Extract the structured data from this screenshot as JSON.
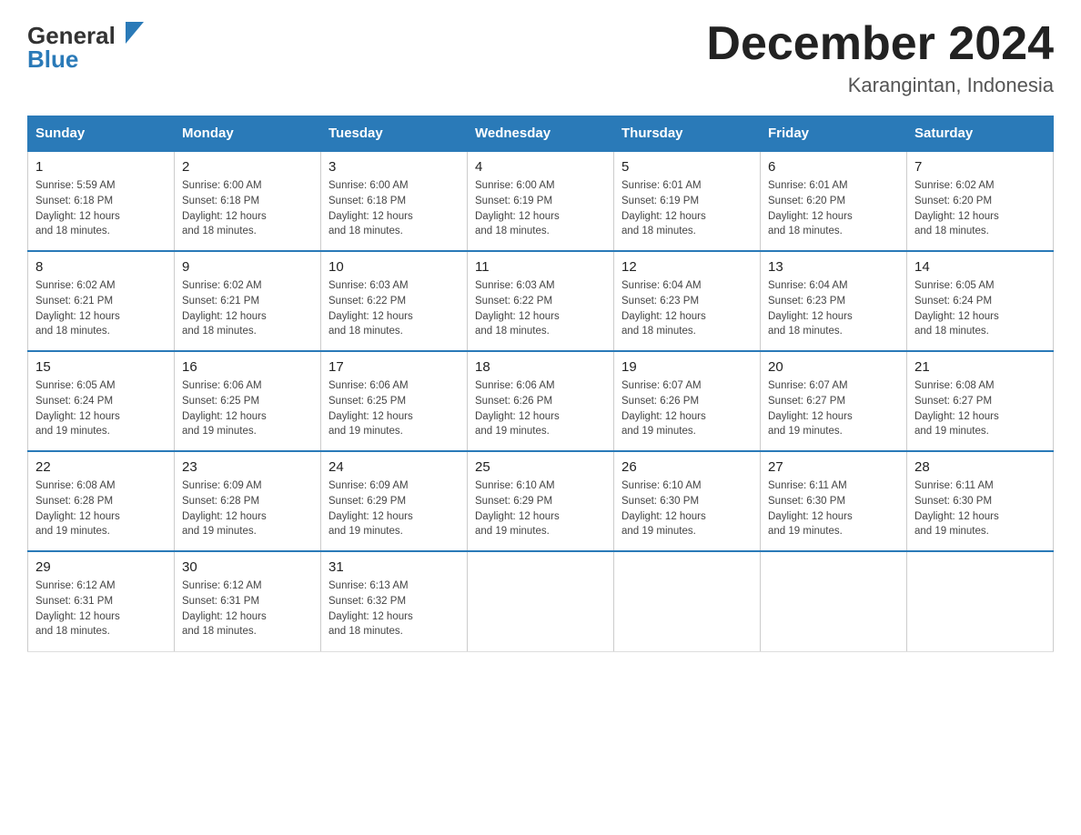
{
  "header": {
    "month_title": "December 2024",
    "location": "Karangintan, Indonesia",
    "logo_general": "General",
    "logo_blue": "Blue"
  },
  "weekdays": [
    "Sunday",
    "Monday",
    "Tuesday",
    "Wednesday",
    "Thursday",
    "Friday",
    "Saturday"
  ],
  "weeks": [
    [
      {
        "day": "1",
        "sunrise": "5:59 AM",
        "sunset": "6:18 PM",
        "daylight": "12 hours and 18 minutes."
      },
      {
        "day": "2",
        "sunrise": "6:00 AM",
        "sunset": "6:18 PM",
        "daylight": "12 hours and 18 minutes."
      },
      {
        "day": "3",
        "sunrise": "6:00 AM",
        "sunset": "6:18 PM",
        "daylight": "12 hours and 18 minutes."
      },
      {
        "day": "4",
        "sunrise": "6:00 AM",
        "sunset": "6:19 PM",
        "daylight": "12 hours and 18 minutes."
      },
      {
        "day": "5",
        "sunrise": "6:01 AM",
        "sunset": "6:19 PM",
        "daylight": "12 hours and 18 minutes."
      },
      {
        "day": "6",
        "sunrise": "6:01 AM",
        "sunset": "6:20 PM",
        "daylight": "12 hours and 18 minutes."
      },
      {
        "day": "7",
        "sunrise": "6:02 AM",
        "sunset": "6:20 PM",
        "daylight": "12 hours and 18 minutes."
      }
    ],
    [
      {
        "day": "8",
        "sunrise": "6:02 AM",
        "sunset": "6:21 PM",
        "daylight": "12 hours and 18 minutes."
      },
      {
        "day": "9",
        "sunrise": "6:02 AM",
        "sunset": "6:21 PM",
        "daylight": "12 hours and 18 minutes."
      },
      {
        "day": "10",
        "sunrise": "6:03 AM",
        "sunset": "6:22 PM",
        "daylight": "12 hours and 18 minutes."
      },
      {
        "day": "11",
        "sunrise": "6:03 AM",
        "sunset": "6:22 PM",
        "daylight": "12 hours and 18 minutes."
      },
      {
        "day": "12",
        "sunrise": "6:04 AM",
        "sunset": "6:23 PM",
        "daylight": "12 hours and 18 minutes."
      },
      {
        "day": "13",
        "sunrise": "6:04 AM",
        "sunset": "6:23 PM",
        "daylight": "12 hours and 18 minutes."
      },
      {
        "day": "14",
        "sunrise": "6:05 AM",
        "sunset": "6:24 PM",
        "daylight": "12 hours and 18 minutes."
      }
    ],
    [
      {
        "day": "15",
        "sunrise": "6:05 AM",
        "sunset": "6:24 PM",
        "daylight": "12 hours and 19 minutes."
      },
      {
        "day": "16",
        "sunrise": "6:06 AM",
        "sunset": "6:25 PM",
        "daylight": "12 hours and 19 minutes."
      },
      {
        "day": "17",
        "sunrise": "6:06 AM",
        "sunset": "6:25 PM",
        "daylight": "12 hours and 19 minutes."
      },
      {
        "day": "18",
        "sunrise": "6:06 AM",
        "sunset": "6:26 PM",
        "daylight": "12 hours and 19 minutes."
      },
      {
        "day": "19",
        "sunrise": "6:07 AM",
        "sunset": "6:26 PM",
        "daylight": "12 hours and 19 minutes."
      },
      {
        "day": "20",
        "sunrise": "6:07 AM",
        "sunset": "6:27 PM",
        "daylight": "12 hours and 19 minutes."
      },
      {
        "day": "21",
        "sunrise": "6:08 AM",
        "sunset": "6:27 PM",
        "daylight": "12 hours and 19 minutes."
      }
    ],
    [
      {
        "day": "22",
        "sunrise": "6:08 AM",
        "sunset": "6:28 PM",
        "daylight": "12 hours and 19 minutes."
      },
      {
        "day": "23",
        "sunrise": "6:09 AM",
        "sunset": "6:28 PM",
        "daylight": "12 hours and 19 minutes."
      },
      {
        "day": "24",
        "sunrise": "6:09 AM",
        "sunset": "6:29 PM",
        "daylight": "12 hours and 19 minutes."
      },
      {
        "day": "25",
        "sunrise": "6:10 AM",
        "sunset": "6:29 PM",
        "daylight": "12 hours and 19 minutes."
      },
      {
        "day": "26",
        "sunrise": "6:10 AM",
        "sunset": "6:30 PM",
        "daylight": "12 hours and 19 minutes."
      },
      {
        "day": "27",
        "sunrise": "6:11 AM",
        "sunset": "6:30 PM",
        "daylight": "12 hours and 19 minutes."
      },
      {
        "day": "28",
        "sunrise": "6:11 AM",
        "sunset": "6:30 PM",
        "daylight": "12 hours and 19 minutes."
      }
    ],
    [
      {
        "day": "29",
        "sunrise": "6:12 AM",
        "sunset": "6:31 PM",
        "daylight": "12 hours and 18 minutes."
      },
      {
        "day": "30",
        "sunrise": "6:12 AM",
        "sunset": "6:31 PM",
        "daylight": "12 hours and 18 minutes."
      },
      {
        "day": "31",
        "sunrise": "6:13 AM",
        "sunset": "6:32 PM",
        "daylight": "12 hours and 18 minutes."
      },
      null,
      null,
      null,
      null
    ]
  ],
  "labels": {
    "sunrise": "Sunrise:",
    "sunset": "Sunset:",
    "daylight": "Daylight:"
  },
  "colors": {
    "header_bg": "#2a7ab8",
    "border": "#2a7ab8",
    "accent": "#2a7ab8"
  }
}
